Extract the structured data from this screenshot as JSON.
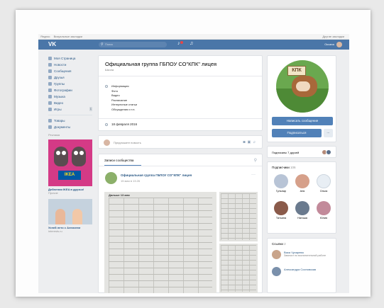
{
  "browser": {
    "bookmarks": [
      "Яндекс",
      "Визуальные закладки"
    ],
    "other_bookmarks": "Другие закладки"
  },
  "topbar": {
    "logo": "VK",
    "search_placeholder": "Поиск",
    "user_name": "Оксана"
  },
  "sidebar": {
    "items": [
      {
        "label": "Моя Страница"
      },
      {
        "label": "Новости"
      },
      {
        "label": "Сообщения"
      },
      {
        "label": "Друзья"
      },
      {
        "label": "Группы"
      },
      {
        "label": "Фотографии"
      },
      {
        "label": "Музыка"
      },
      {
        "label": "Видео"
      },
      {
        "label": "Игры",
        "badge": "1"
      }
    ],
    "items2": [
      {
        "label": "Товары"
      },
      {
        "label": "Документы"
      }
    ],
    "ads_title": "Реклама",
    "ad1": {
      "title": "Дебютная IKEA в друзья!",
      "sub": "Прочие",
      "brand": "IKEA"
    },
    "ad2": {
      "title": "Успей лето с Алексеем",
      "sub": "interests.ru"
    }
  },
  "group": {
    "title": "Официальная группа ГБПОУ СО\"КПК\" лицея",
    "status": "Школа",
    "info": [
      "Информация",
      "Фото",
      "Видео",
      "Расписание",
      "Интересные статьи",
      "Обсуждения и т.п."
    ],
    "date": "18 февраля 2016"
  },
  "suggest": {
    "placeholder": "Предложите новость",
    "icons": [
      "camera-icon",
      "video-icon",
      "music-icon"
    ]
  },
  "wall": {
    "tab": "Записи сообщества",
    "post": {
      "author": "Официальная группа ГБПОУ СО\"КПК\" лицея",
      "date": "15 мая в 13:26",
      "photo_label": "Дальше 13 мая"
    }
  },
  "right": {
    "avatar_sign": "КПК",
    "send_message": "Написать сообщение",
    "subscribe": "Подписаться",
    "more": "...",
    "friends": "Подписаны 7 друзей",
    "subscribers_title": "Подписчики",
    "subscribers_count": "106",
    "subscribers": [
      {
        "name": "Гульнар",
        "color": "#b8c4d6"
      },
      {
        "name": "Аня",
        "color": "#d6a08a"
      },
      {
        "name": "Ольга",
        "color": "#e8eef4"
      },
      {
        "name": "Татьяна",
        "color": "#8a5a4a"
      },
      {
        "name": "Наташа",
        "color": "#6a7a8e"
      },
      {
        "name": "Юлия",
        "color": "#c28a9a"
      }
    ],
    "links_title": "Ссылки",
    "links_count": "2",
    "links": [
      {
        "name": "Вика Чухарева",
        "desc": "Зампост по воспитательной работе",
        "color": "#c9a48a"
      },
      {
        "name": "Александра Сосновская",
        "desc": "",
        "color": "#7a90ab"
      }
    ]
  }
}
